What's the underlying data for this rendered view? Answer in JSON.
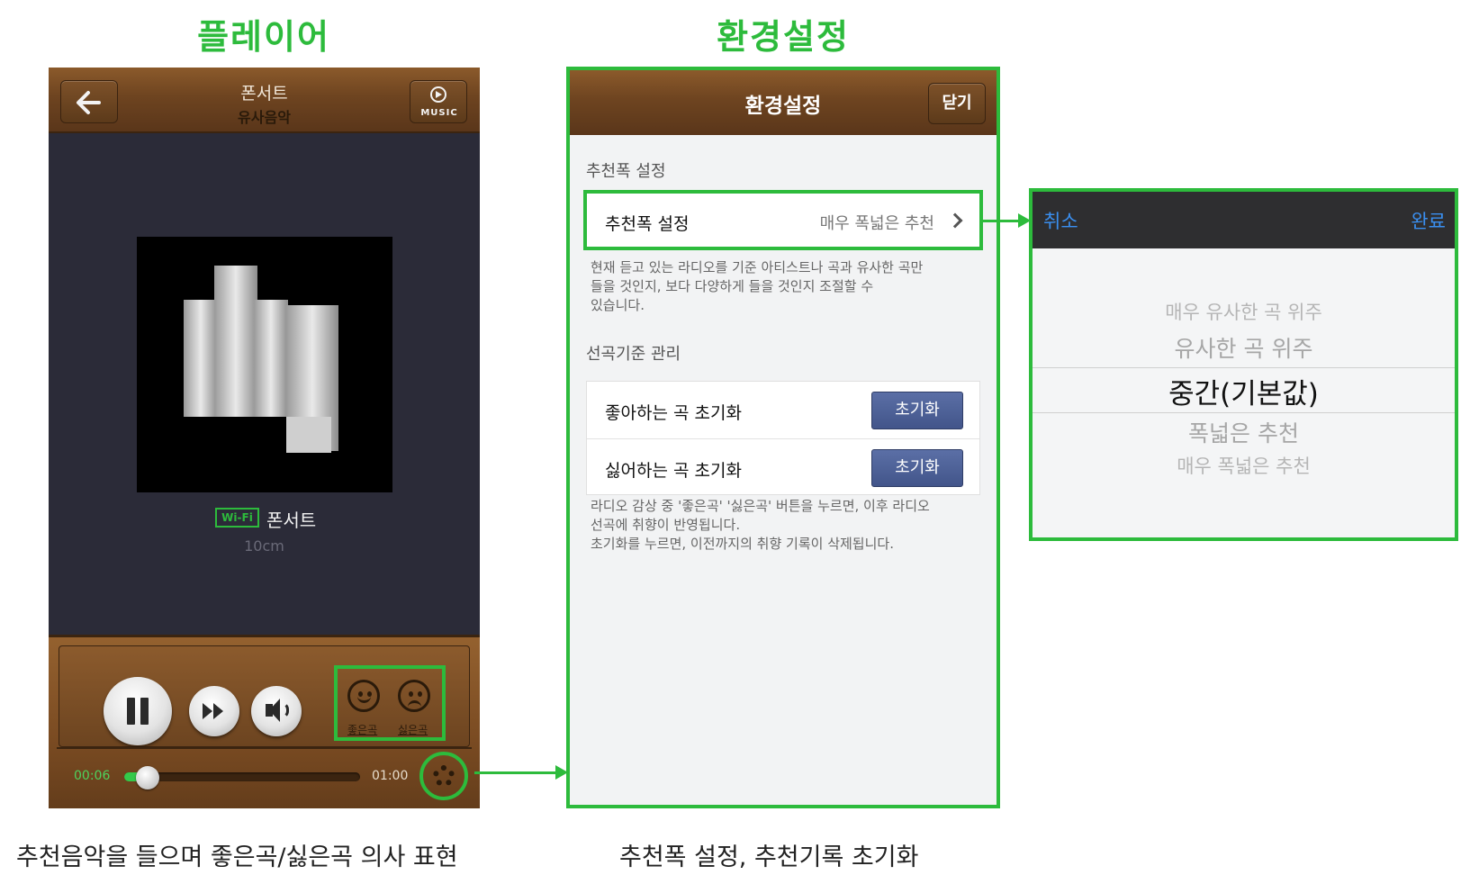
{
  "headings": {
    "player": "플레이어",
    "settings": "환경설정"
  },
  "captions": {
    "player": "추천음악을 들으며 좋은곡/싫은곡 의사 표현",
    "settings": "추천폭 설정, 추천기록 초기화"
  },
  "player": {
    "title": "폰서트",
    "subtitle": "유사음악",
    "music_label": "MUSIC",
    "network_badge": "Wi-Fi",
    "song": "폰서트",
    "artist": "10cm",
    "like_label": "좋은곡",
    "dislike_label": "싫은곡",
    "current_time": "00:06",
    "total_time": "01:00",
    "progress": 0.1,
    "icons": [
      "back-arrow-icon",
      "music-play-icon",
      "pause-icon",
      "fast-forward-icon",
      "volume-icon",
      "smile-icon",
      "frown-icon",
      "gear-icon"
    ]
  },
  "settings": {
    "title": "환경설정",
    "close": "닫기",
    "section1_header": "추천폭 설정",
    "row_label": "추천폭 설정",
    "row_value": "매우 폭넓은 추천",
    "desc1": [
      "현재 듣고 있는 라디오를 기준 아티스트나 곡과 유사한 곡만",
      "들을 것인지, 보다 다양하게 들을 것인지 조절할 수",
      "있습니다."
    ],
    "section2_header": "선곡기준 관리",
    "reset_like_label": "좋아하는 곡 초기화",
    "reset_dislike_label": "싫어하는 곡 초기화",
    "reset_button": "초기화",
    "desc2": [
      "라디오 감상 중 '좋은곡' '싫은곡' 버튼을 누르면, 이후 라디오",
      "선곡에 취향이 반영됩니다.",
      "초기화를 누르면, 이전까지의 취향 기록이 삭제됩니다."
    ]
  },
  "picker": {
    "cancel": "취소",
    "done": "완료",
    "options": [
      "매우 유사한 곡 위주",
      "유사한 곡 위주",
      "중간(기본값)",
      "폭넓은 추천",
      "매우 폭넓은 추천"
    ],
    "selected_index": 2
  },
  "colors": {
    "highlight": "#2dbb3c",
    "accent_blue": "#3a8ff0",
    "wood": "#6e4420",
    "reset_button": "#4b5f98"
  }
}
